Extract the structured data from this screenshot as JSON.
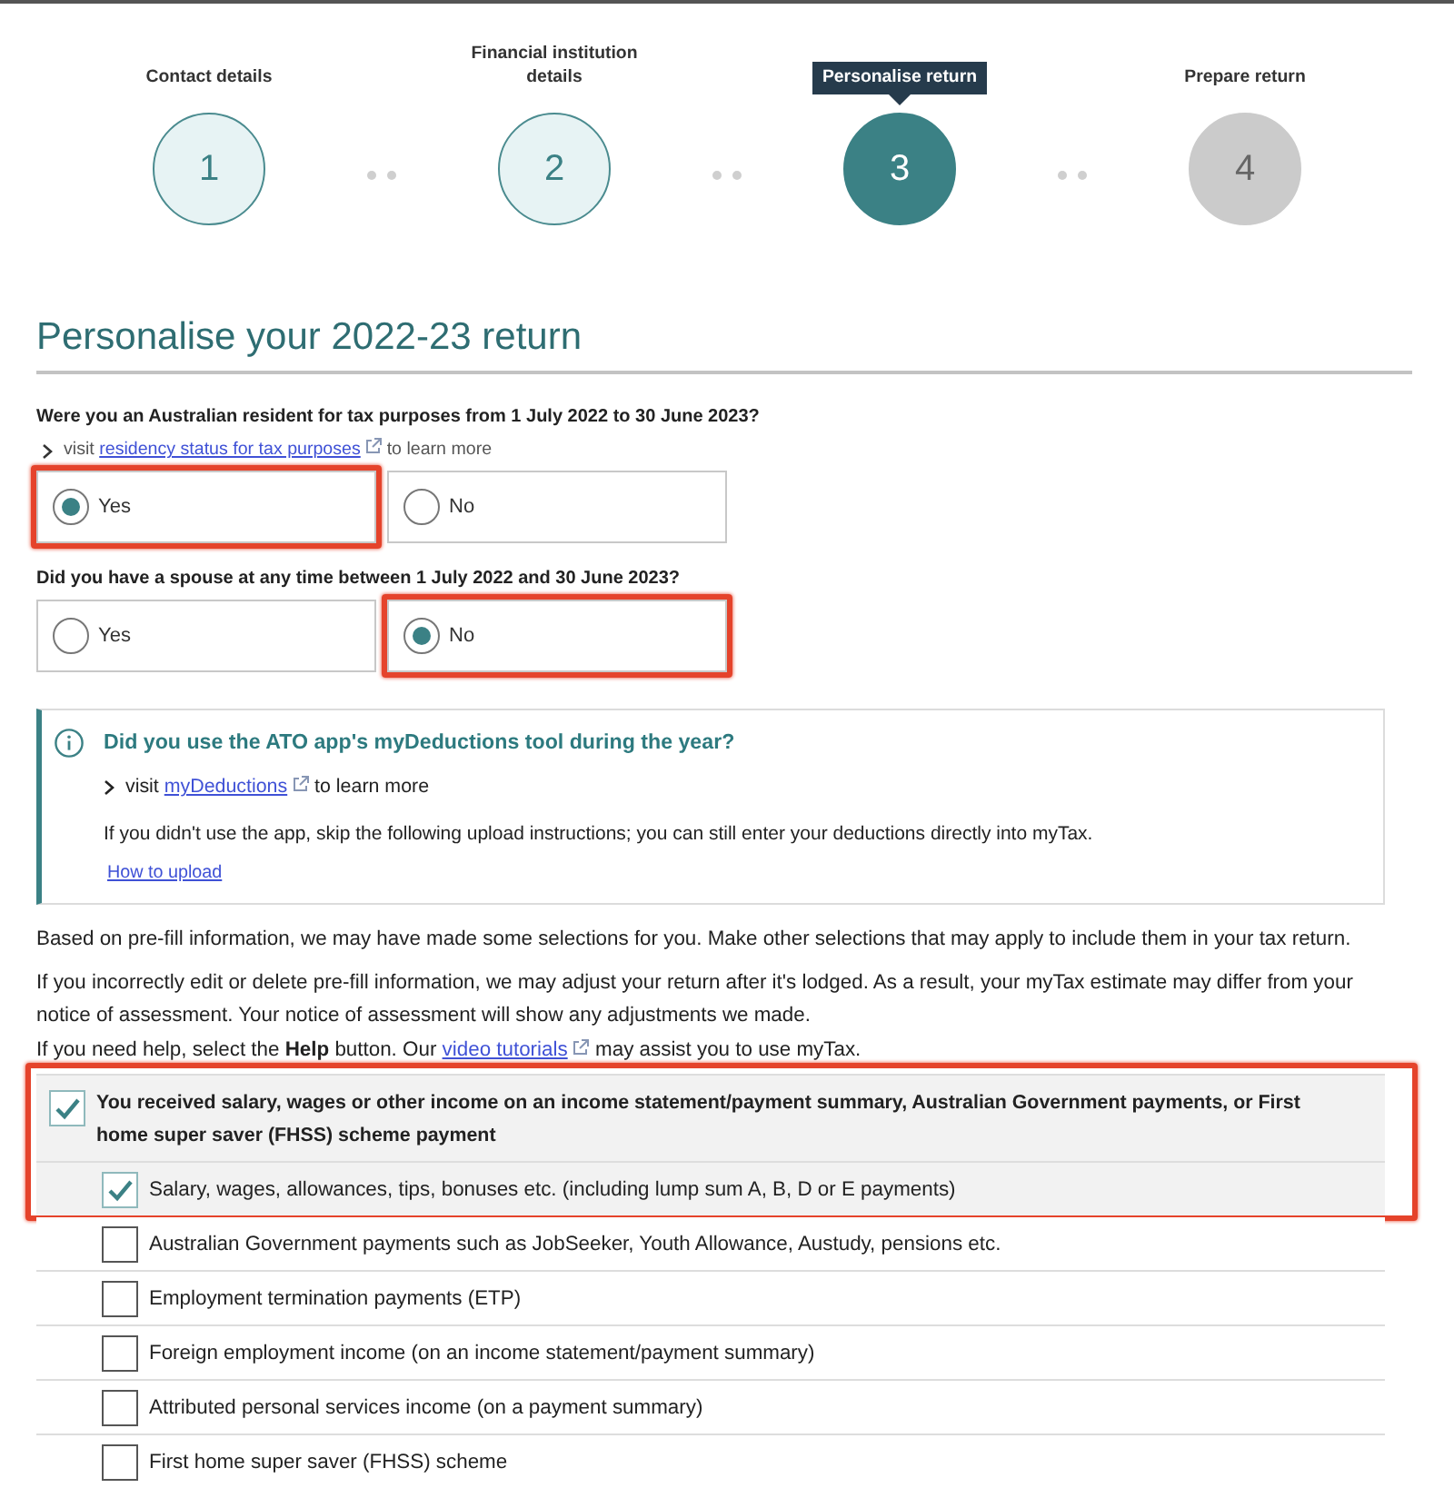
{
  "stepper": {
    "steps": [
      {
        "number": "1",
        "label": "Contact details",
        "completed": true,
        "selected": false
      },
      {
        "number": "2",
        "label": "Financial institution details",
        "completed": true,
        "selected": false
      },
      {
        "number": "3",
        "label": "Personalise return",
        "completed": false,
        "selected": true
      },
      {
        "number": "4",
        "label": "Prepare return",
        "completed": false,
        "selected": false
      }
    ]
  },
  "page_title": "Personalise your 2022-23 return",
  "questions": [
    {
      "question": "Were you an Australian resident for tax purposes from 1 July 2022 to 30 June 2023?",
      "hint": {
        "prefix": "visit",
        "link": "residency status for tax purposes",
        "suffix": "to learn more"
      },
      "options": [
        {
          "label": "Yes",
          "selected": true,
          "highlighted": true
        },
        {
          "label": "No",
          "selected": false,
          "highlighted": false
        }
      ]
    },
    {
      "question": "Did you have a spouse at any time between 1 July 2022 and 30 June 2023?",
      "options": [
        {
          "label": "Yes",
          "selected": false,
          "highlighted": false
        },
        {
          "label": "No",
          "selected": true,
          "highlighted": true
        }
      ]
    }
  ],
  "info_box": {
    "title": "Did you use the ATO app's myDeductions tool during the year?",
    "hint": {
      "prefix": "visit",
      "link": "myDeductions",
      "suffix": "to learn more"
    },
    "text": "If you didn't use the app, skip the following upload instructions; you can still enter your deductions directly into myTax.",
    "link": "How to upload"
  },
  "paragraphs": [
    {
      "text": "Based on pre-fill information, we may have made some selections for you. Make other selections that may apply to include them in your tax return."
    },
    {
      "text": "If you incorrectly edit or delete pre-fill information, we may adjust your return after it's lodged. As a result, your myTax estimate may differ from your notice of assessment. Your notice of assessment will show any adjustments we made."
    },
    {
      "text": "If you need help, select the **Help** button. Our",
      "link": "video tutorials",
      "after": "may assist you to use myTax."
    }
  ],
  "income_checklist": {
    "label": "You received salary, wages or other income on an income statement/payment summary, Australian Government payments, or First home super saver (FHSS) scheme payment",
    "checked": true,
    "highlighted": true,
    "children": [
      {
        "label": "Salary, wages, allowances, tips, bonuses etc. (including lump sum A, B, D or E payments)",
        "checked": true,
        "highlighted": true
      },
      {
        "label": "Australian Government payments such as JobSeeker, Youth Allowance, Austudy, pensions etc.",
        "checked": false,
        "highlighted": false
      },
      {
        "label": "Employment termination payments (ETP)",
        "checked": false,
        "highlighted": false
      },
      {
        "label": "Foreign employment income (on an income statement/payment summary)",
        "checked": false,
        "highlighted": false
      },
      {
        "label": "Attributed personal services income (on a payment summary)",
        "checked": false,
        "highlighted": false
      },
      {
        "label": "First home super saver (FHSS) scheme",
        "checked": false,
        "highlighted": false
      }
    ]
  }
}
